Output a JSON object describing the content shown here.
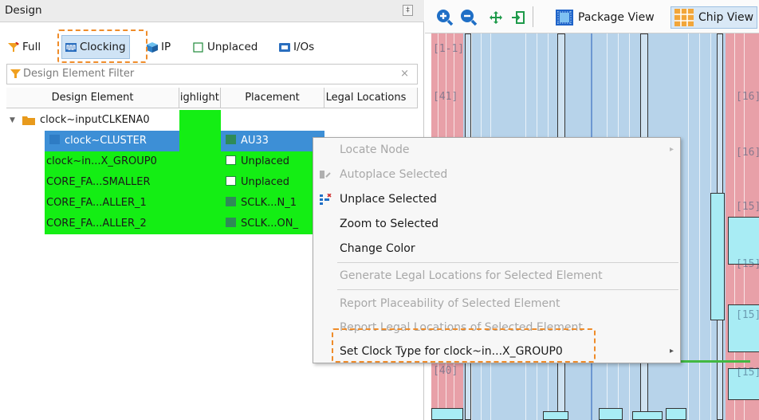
{
  "panel": {
    "title": "Design",
    "pin_glyph": "‡"
  },
  "filters": [
    {
      "label": "Full",
      "icon": "full-filter-icon",
      "selected": false
    },
    {
      "label": "Clocking",
      "icon": "clocking-icon",
      "selected": true
    },
    {
      "label": "IP",
      "icon": "ip-icon",
      "selected": false
    },
    {
      "label": "Unplaced",
      "icon": "unplaced-checkbox-icon",
      "selected": false
    },
    {
      "label": "I/Os",
      "icon": "io-icon",
      "selected": false
    }
  ],
  "search": {
    "placeholder": "Design Element Filter",
    "clear": "×"
  },
  "table": {
    "columns": [
      "Design Element",
      "Highlight",
      "Placement",
      "Legal Locations"
    ],
    "rows": [
      {
        "element": "clock~inputCLKENA0",
        "placement": "",
        "placement_color": "",
        "group": true,
        "selected": false
      },
      {
        "element": "clock~CLUSTER",
        "placement": "AU33",
        "placement_color": "#2e8b57",
        "group": false,
        "selected": true
      },
      {
        "element": "clock~in...X_GROUP0",
        "placement": "Unplaced",
        "placement_color": "",
        "group": false,
        "selected": false
      },
      {
        "element": "CORE_FA...SMALLER",
        "placement": "Unplaced",
        "placement_color": "",
        "group": false,
        "selected": false
      },
      {
        "element": "CORE_FA...ALLER_1",
        "placement": "SCLK...N_1",
        "placement_color": "#2e8b57",
        "group": false,
        "selected": false
      },
      {
        "element": "CORE_FA...ALLER_2",
        "placement": "SCLK...ON_",
        "placement_color": "#2e8b57",
        "group": false,
        "selected": false
      }
    ]
  },
  "toolbar": {
    "package_view": "Package View",
    "chip_view": "Chip View"
  },
  "chip": {
    "labels": [
      "[41]",
      "[16]",
      "[15]",
      "[15]",
      "[15]",
      "[40]",
      "[15]",
      "[1-1]"
    ]
  },
  "menu": {
    "items": [
      {
        "label": "Locate Node",
        "enabled": false,
        "submenu": true,
        "icon": ""
      },
      {
        "label": "Autoplace Selected",
        "enabled": false,
        "submenu": false,
        "icon": "autoplace-icon"
      },
      {
        "label": "Unplace Selected",
        "enabled": true,
        "submenu": false,
        "icon": "unplace-icon"
      },
      {
        "label": "Zoom to Selected",
        "enabled": true,
        "submenu": false,
        "icon": ""
      },
      {
        "label": "Change Color",
        "enabled": true,
        "submenu": false,
        "icon": ""
      },
      {
        "label": "Generate Legal Locations for Selected Element",
        "enabled": false,
        "submenu": false,
        "icon": ""
      },
      {
        "label": "Report Placeability of Selected Element",
        "enabled": false,
        "submenu": false,
        "icon": ""
      },
      {
        "label": "Report Legal Locations of Selected Element",
        "enabled": false,
        "submenu": false,
        "icon": ""
      },
      {
        "label": "Set Clock Type for clock~in...X_GROUP0",
        "enabled": true,
        "submenu": true,
        "icon": ""
      }
    ],
    "submenu_arrow": "▸"
  },
  "colors": {
    "highlight_green": "#14ee14",
    "selection_blue": "#3d8fd6",
    "annotation_orange": "#ef8c2a",
    "chip_blue": "#b7d3ea",
    "chip_pink": "#e8a0a8"
  }
}
